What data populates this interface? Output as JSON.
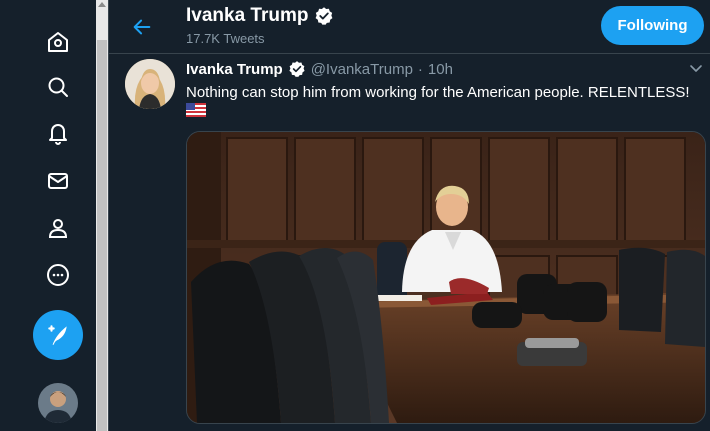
{
  "header": {
    "title": "Ivanka Trump",
    "subtitle": "17.7K Tweets",
    "follow_label": "Following"
  },
  "tweet": {
    "name": "Ivanka Trump",
    "handle": "@IvankaTrump",
    "separator": "·",
    "time": "10h",
    "text": "Nothing can stop him from working for the American people. RELENTLESS!",
    "emoji": "us-flag"
  },
  "nav": {
    "icons": [
      "home-icon",
      "search-icon",
      "bell-icon",
      "mail-icon",
      "profile-icon",
      "more-icon",
      "compose-icon"
    ]
  },
  "colors": {
    "background": "#15202b",
    "accent": "#1da1f2",
    "muted": "#8899a6",
    "border": "#38444d"
  }
}
